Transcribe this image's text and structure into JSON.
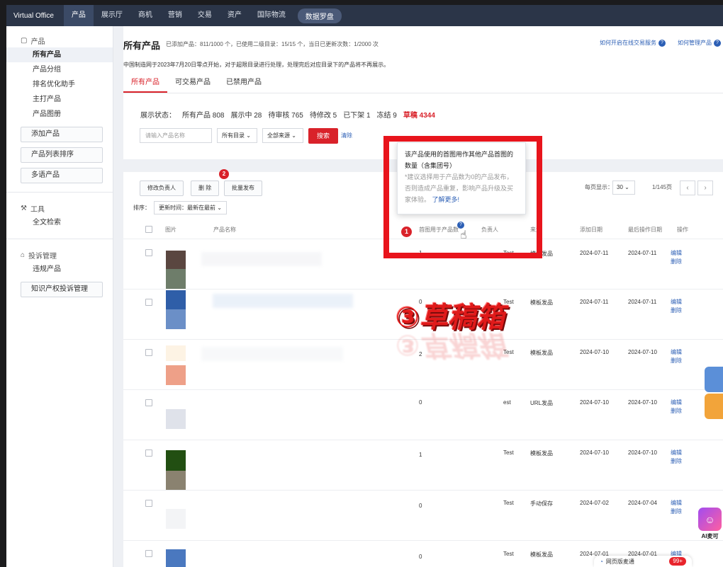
{
  "topnav": {
    "brand": "Virtual Office",
    "items": [
      "产品",
      "展示厅",
      "商机",
      "营销",
      "交易",
      "资产",
      "国际物流"
    ],
    "active_index": 0,
    "pill": "数据罗盘"
  },
  "sidebar": {
    "group_product": "产品",
    "items": [
      "所有产品",
      "产品分组",
      "排名优化助手",
      "主打产品",
      "产品图册"
    ],
    "buttons": [
      "添加产品",
      "产品列表排序",
      "多语产品"
    ],
    "group_tools": "工具",
    "tools_items": [
      "全文检索"
    ],
    "group_complaint": "投诉管理",
    "complaint_items": [
      "违规产品"
    ],
    "ip_button": "知识产权投诉管理"
  },
  "header": {
    "title": "所有产品",
    "subinfo": "已添加产品：811/1000 个，已使用二级目录：15/15 个，当日已更新次数：1/2000 次",
    "link1": "如何开启在线交易服务",
    "link2": "如何管理产品",
    "notice": "中国制造网于2023年7月20日零点开始，对于超限目录进行处理，处理完后对应目录下的产品将不再展示。"
  },
  "tabs": [
    "所有产品",
    "可交易产品",
    "已禁用产品"
  ],
  "filter": {
    "status_label": "展示状态：",
    "statuses": [
      "所有产品 808",
      "展示中 28",
      "待审核 765",
      "待修改 5",
      "已下架 1",
      "冻结 9"
    ],
    "draft": "草稿 4344",
    "search_placeholder": "请输入产品名称",
    "category": "所有目录",
    "source": "全部来源",
    "search_btn": "搜索",
    "clear": "清除"
  },
  "actions": {
    "modify_owner": "修改负责人",
    "delete": "删 除",
    "batch_publish": "批量发布",
    "batch_badge": "2",
    "sort_label": "排序：",
    "sort_value": "更新时间：最新在最前",
    "per_page_label": "每页显示：",
    "per_page": "30",
    "page_info": "1/145页"
  },
  "table": {
    "headers": [
      "图片",
      "产品名称",
      "首图用于产品数",
      "负责人",
      "来源",
      "添加日期",
      "最后操作日期",
      "操作"
    ],
    "rows": [
      {
        "count": "1",
        "owner": "Test",
        "source": "模板发品",
        "added": "2024-07-11",
        "last": "2024-07-11"
      },
      {
        "count": "0",
        "owner": "Test",
        "source": "模板发品",
        "added": "2024-07-11",
        "last": "2024-07-11"
      },
      {
        "count": "2",
        "owner": "Test",
        "source": "模板发品",
        "added": "2024-07-10",
        "last": "2024-07-10"
      },
      {
        "count": "0",
        "owner": "est",
        "source": "URL发品",
        "added": "2024-07-10",
        "last": "2024-07-10"
      },
      {
        "count": "1",
        "owner": "Test",
        "source": "模板发品",
        "added": "2024-07-10",
        "last": "2024-07-10"
      },
      {
        "count": "0",
        "owner": "Test",
        "source": "手动保存",
        "added": "2024-07-02",
        "last": "2024-07-04"
      },
      {
        "count": "0",
        "owner": "Test",
        "source": "模板发品",
        "added": "2024-07-01",
        "last": "2024-07-01"
      }
    ],
    "edit": "编辑",
    "delete": "删除"
  },
  "tooltip": {
    "line1": "该产品使用的首图用作其他产品首图的数量（含集团号）",
    "line2": "*建议选择用于产品数为0的产品发布，否则造成产品重复，影响产品升级及买家体验。",
    "more": "了解更多!"
  },
  "annotations": {
    "badge1": "1",
    "watermark": "③草稿箱"
  },
  "widgets": {
    "ai_label": "AI麦可",
    "chat_label": "网页版麦通",
    "chat_count": "99+"
  },
  "colors": {
    "accent_red": "#d9222a",
    "link_blue": "#2c5fb5",
    "nav_bg": "#2b3548"
  }
}
